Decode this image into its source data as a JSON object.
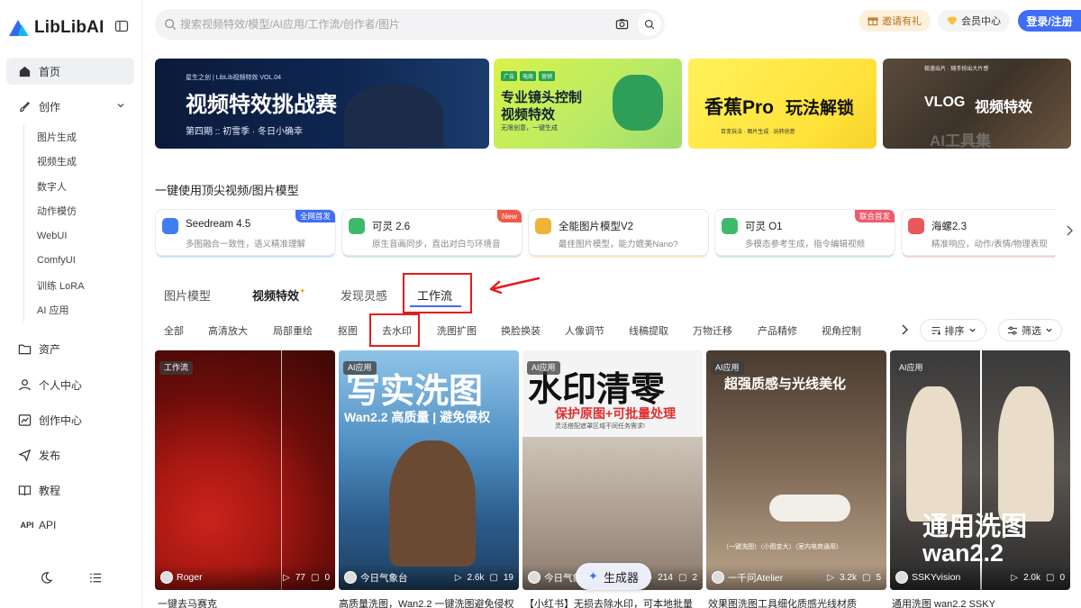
{
  "brand": {
    "name": "LibLibAI"
  },
  "sidebar": {
    "home": "首页",
    "create": "创作",
    "sub": [
      "图片生成",
      "视频生成",
      "数字人",
      "动作模仿",
      "WebUI",
      "ComfyUI",
      "训练 LoRA",
      "AI 应用"
    ],
    "assets": "资产",
    "personal": "个人中心",
    "creator": "创作中心",
    "publish": "发布",
    "tutorial": "教程",
    "api": "API"
  },
  "topbar": {
    "search_placeholder": "搜索视频特效/模型/AI应用/工作流/创作者/图片",
    "invite": "邀请有礼",
    "member": "会员中心",
    "login": "登录/注册"
  },
  "banners": [
    {
      "title": "视频特效挑战赛",
      "kicker": "星生之创 | LibLib视频特效 VOL.04",
      "sub": "第四期 :: 初雪季 · 冬日小确幸"
    },
    {
      "title": "专业镜头控制",
      "title2": "视频特效",
      "chips": [
        "广告",
        "电商",
        "营销"
      ],
      "sub": "无限创意，一键生成"
    },
    {
      "title": "香蕉Pro",
      "title2": "玩法解锁",
      "sub": "百变玩法 · 图片生成 · 玩转创意"
    },
    {
      "title": "VLOG",
      "title2": "视频特效",
      "kicker": "极速出片 · 随手拍出大片感"
    }
  ],
  "watermark": "AI工具集",
  "models_title": "一键使用顶尖视频/图片模型",
  "models": [
    {
      "name": "Seedream 4.5",
      "desc": "多图融合一致性，语义精准理解",
      "tag": "全网首发",
      "tag_color": "#3f6ef5",
      "icon_color": "#3f7ef0",
      "glow": "#cfe0ff"
    },
    {
      "name": "可灵 2.6",
      "desc": "原生音画同步，直出对白与环境音",
      "tag": "New",
      "tag_color": "#f15a4a",
      "icon_color": "#3dbb6a",
      "glow": "#cfead8"
    },
    {
      "name": "全能图片模型V2",
      "desc": "最佳图片模型，能力媲美Nano?",
      "tag": "",
      "tag_color": "",
      "icon_color": "#f0b43a",
      "glow": "#fde6c4"
    },
    {
      "name": "可灵 O1",
      "desc": "多模态参考生成，指令编辑视频",
      "tag": "联合首发",
      "tag_color": "#f15a6a",
      "icon_color": "#3dbb6a",
      "glow": "#cfead8"
    },
    {
      "name": "海螺2.3",
      "desc": "精准响应，动作/表情/物理表现",
      "tag": "",
      "tag_color": "",
      "icon_color": "#e85a5a",
      "glow": "#f7d2d2"
    }
  ],
  "tabs": [
    "图片模型",
    "视频特效",
    "发现灵感",
    "工作流"
  ],
  "chips": [
    "全部",
    "高清放大",
    "局部重绘",
    "抠图",
    "去水印",
    "洗图扩图",
    "换脸换装",
    "人像调节",
    "线稿提取",
    "万物迁移",
    "产品精修",
    "视角控制"
  ],
  "sort": "排序",
  "filter": "筛选",
  "generate": "生成器",
  "cards": [
    {
      "tag": "工作流",
      "author": "Roger",
      "likes": "77",
      "comments": "0",
      "title": "一键去马赛克",
      "overlay": ""
    },
    {
      "tag": "AI应用",
      "author": "今日气象台",
      "likes": "2.6k",
      "comments": "19",
      "title": "高质量洗图，Wan2.2 一键洗图避免侵权",
      "overlay": "写实洗图",
      "overlay2": "Wan2.2 高质量 | 避免侵权"
    },
    {
      "tag": "AI应用",
      "author": "今日气象台",
      "likes": "214",
      "comments": "2",
      "title": "【小红书】无损去除水印，可本地批量",
      "overlay": "水印清零",
      "overlay2": "保护原图+可批量处理",
      "overlay3": "灵活搭配遮罩区域不同任务需求!"
    },
    {
      "tag": "AI应用",
      "author": "一千问Atelier",
      "likes": "3.2k",
      "comments": "5",
      "title": "效果图洗图工具细化质感光线材质",
      "overlay": "超强质感与光线美化",
      "overlay2": "（一键洗图）（小图变大）（室内电商通用）"
    },
    {
      "tag": "AI应用",
      "author": "SSKYvision",
      "likes": "2.0k",
      "comments": "0",
      "title": "通用洗图 wan2.2 SSKY",
      "overlay": "通用洗图",
      "overlay2": "wan2.2"
    }
  ],
  "colors": {
    "accent": "#3f6ef5",
    "highlight": "#e51d1d"
  }
}
